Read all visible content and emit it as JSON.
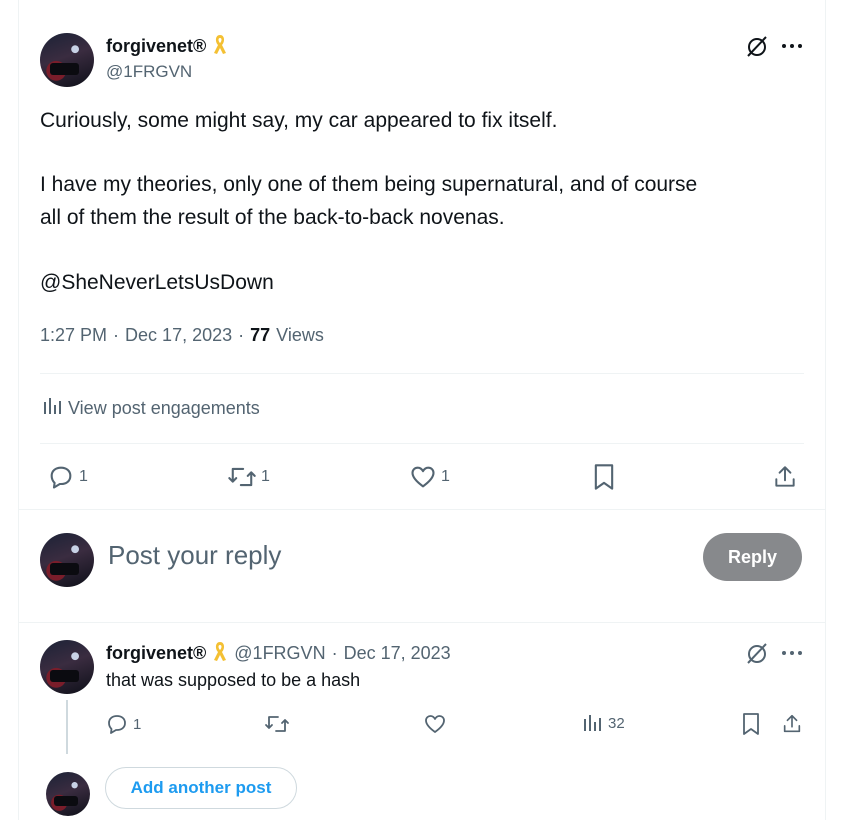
{
  "post": {
    "display_name": "forgivenet®",
    "handle": "@1FRGVN",
    "text_line1": "Curiously, some might say, my car appeared to fix itself.",
    "text_line2": "I have my theories, only one of them being supernatural, and of course",
    "text_line3": "all of them the result of the back-to-back novenas.",
    "mention": "@SheNeverLetsUsDown",
    "time": "1:27 PM",
    "date": "Dec 17, 2023",
    "views_count": "77",
    "views_label": "Views",
    "engagements_label": "View post engagements",
    "reply_count": "1",
    "repost_count": "1",
    "like_count": "1"
  },
  "composer": {
    "placeholder": "Post your reply",
    "reply_button": "Reply"
  },
  "reply": {
    "display_name": "forgivenet®",
    "handle": "@1FRGVN",
    "date": "Dec 17, 2023",
    "text": "that was supposed to be a hash",
    "reply_count": "1",
    "views_count": "32"
  },
  "footer": {
    "add_post": "Add another post"
  },
  "icons": {
    "ribbon": "yellow-ribbon-icon",
    "grok": "slash-circle-icon",
    "more": "more-dots-icon",
    "reply": "reply-icon",
    "repost": "repost-icon",
    "like": "like-icon",
    "bookmark": "bookmark-icon",
    "share": "share-icon",
    "analytics": "analytics-icon"
  },
  "colors": {
    "ribbon": "#f4c033",
    "link": "#1d9bf0",
    "muted": "#536471",
    "reply_button_bg": "#87898c"
  }
}
